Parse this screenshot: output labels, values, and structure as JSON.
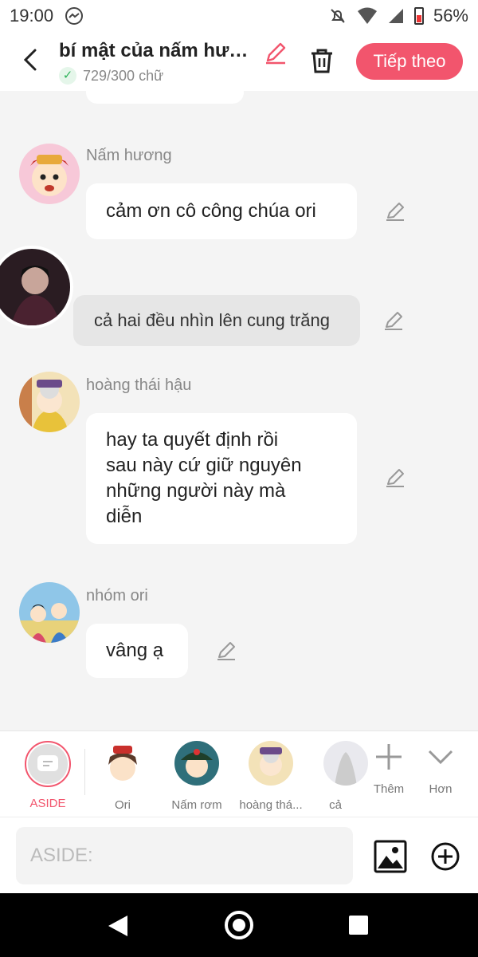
{
  "status_bar": {
    "time": "19:00",
    "battery": "56%",
    "icons": [
      "messenger-icon",
      "mute-icon",
      "wifi-icon",
      "signal-icon",
      "battery-icon"
    ]
  },
  "header": {
    "title": "bí mật của nấm hương",
    "word_count": "729/300 chữ",
    "next_label": "Tiếp theo"
  },
  "messages": [
    {
      "speaker": "Nấm hương",
      "text": "cảm ơn cô công chúa ori"
    },
    {
      "speaker": "",
      "text": "cả hai đều nhìn lên cung trăng"
    },
    {
      "speaker": "hoàng thái hậu",
      "lines": [
        "hay ta quyết định rồi",
        "sau này cứ giữ nguyên",
        "những người này mà",
        "diễn"
      ]
    },
    {
      "speaker": "nhóm ori",
      "text": "vâng ạ"
    }
  ],
  "characters": [
    {
      "label": "ASIDE",
      "selected": true
    },
    {
      "label": "Ori"
    },
    {
      "label": "Nấm rơm"
    },
    {
      "label": "hoàng thá..."
    },
    {
      "label": "cả"
    }
  ],
  "actions": {
    "add_label": "Thêm",
    "more_label": "Hơn"
  },
  "input": {
    "placeholder": "ASIDE:"
  },
  "colors": {
    "accent": "#f2556d",
    "success": "#2fb45a"
  }
}
